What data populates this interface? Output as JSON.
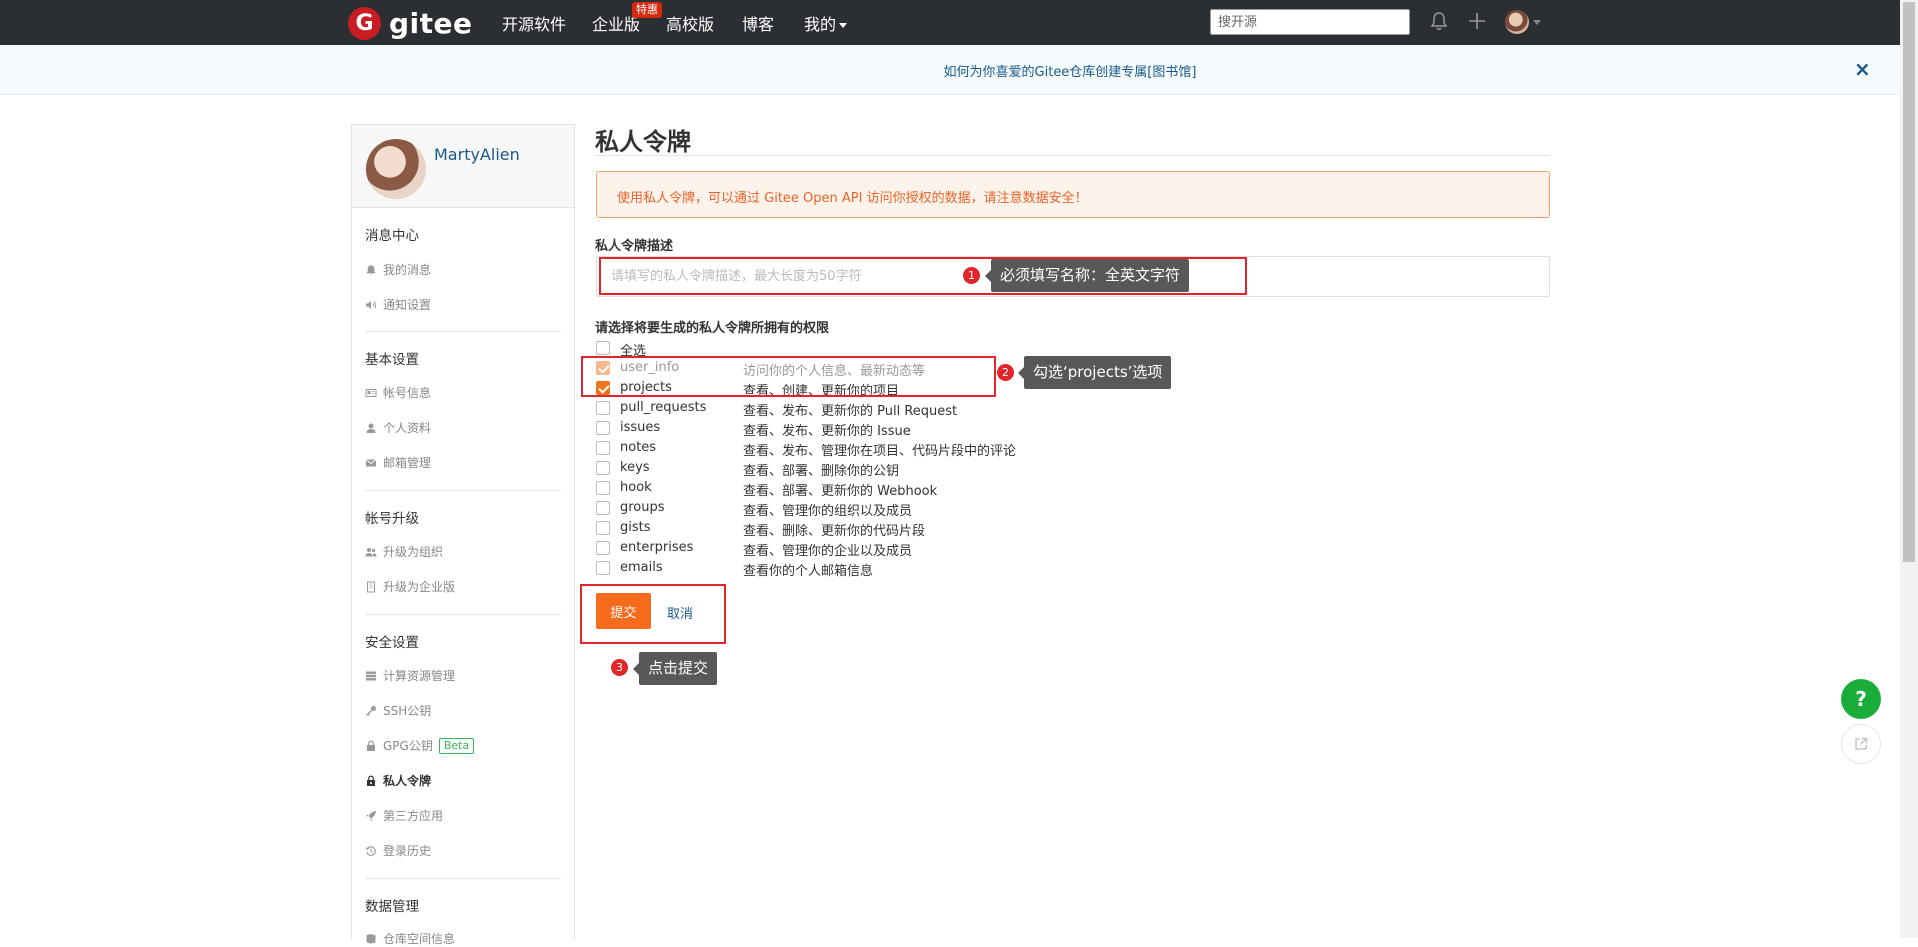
{
  "nav": {
    "logo_letter": "G",
    "logo_text": "gitee",
    "links": [
      "开源软件",
      "企业版",
      "高校版",
      "博客",
      "我的"
    ],
    "enterprise_badge": "特惠",
    "search_placeholder": "搜开源"
  },
  "notice": {
    "text": "如何为你喜爱的Gitee仓库创建专属[图书馆]",
    "close": "×"
  },
  "sidebar": {
    "username": "MartyAlien",
    "sections": [
      {
        "title": "消息中心",
        "items": [
          "我的消息",
          "通知设置"
        ]
      },
      {
        "title": "基本设置",
        "items": [
          "帐号信息",
          "个人资料",
          "邮箱管理"
        ]
      },
      {
        "title": "帐号升级",
        "items": [
          "升级为组织",
          "升级为企业版"
        ]
      },
      {
        "title": "安全设置",
        "items": [
          "计算资源管理",
          "SSH公钥",
          "GPG公钥",
          "私人令牌",
          "第三方应用",
          "登录历史"
        ]
      },
      {
        "title": "数据管理",
        "items": [
          "仓库空间信息"
        ]
      }
    ],
    "beta_label": "Beta"
  },
  "main": {
    "title": "私人令牌",
    "warning": "使用私人令牌，可以通过 Gitee Open API 访问你授权的数据，请注意数据安全！",
    "desc_label": "私人令牌描述",
    "desc_placeholder": "请填写的私人令牌描述，最大长度为50字符",
    "perm_label": "请选择将要生成的私人令牌所拥有的权限",
    "select_all": "全选",
    "permissions": [
      {
        "name": "user_info",
        "desc": "访问你的个人信息、最新动态等",
        "checked": true,
        "disabled": true
      },
      {
        "name": "projects",
        "desc": "查看、创建、更新你的项目",
        "checked": true,
        "disabled": false
      },
      {
        "name": "pull_requests",
        "desc": "查看、发布、更新你的 Pull Request",
        "checked": false,
        "disabled": false
      },
      {
        "name": "issues",
        "desc": "查看、发布、更新你的 Issue",
        "checked": false,
        "disabled": false
      },
      {
        "name": "notes",
        "desc": "查看、发布、管理你在项目、代码片段中的评论",
        "checked": false,
        "disabled": false
      },
      {
        "name": "keys",
        "desc": "查看、部署、删除你的公钥",
        "checked": false,
        "disabled": false
      },
      {
        "name": "hook",
        "desc": "查看、部署、更新你的 Webhook",
        "checked": false,
        "disabled": false
      },
      {
        "name": "groups",
        "desc": "查看、管理你的组织以及成员",
        "checked": false,
        "disabled": false
      },
      {
        "name": "gists",
        "desc": "查看、删除、更新你的代码片段",
        "checked": false,
        "disabled": false
      },
      {
        "name": "enterprises",
        "desc": "查看、管理你的企业以及成员",
        "checked": false,
        "disabled": false
      },
      {
        "name": "emails",
        "desc": "查看你的个人邮箱信息",
        "checked": false,
        "disabled": false
      }
    ],
    "submit": "提交",
    "cancel": "取消"
  },
  "annotations": [
    {
      "num": "1",
      "text": "必须填写名称：全英文字符"
    },
    {
      "num": "2",
      "text": "勾选‘projects’选项"
    },
    {
      "num": "3",
      "text": "点击提交"
    }
  ],
  "floating": {
    "help": "?"
  },
  "colors": {
    "nav_bg": "#2b2e33",
    "accent_orange": "#f76b1c",
    "link_blue": "#1a5a8a",
    "annotation_red": "#e0262b",
    "help_green": "#1aad3a"
  }
}
